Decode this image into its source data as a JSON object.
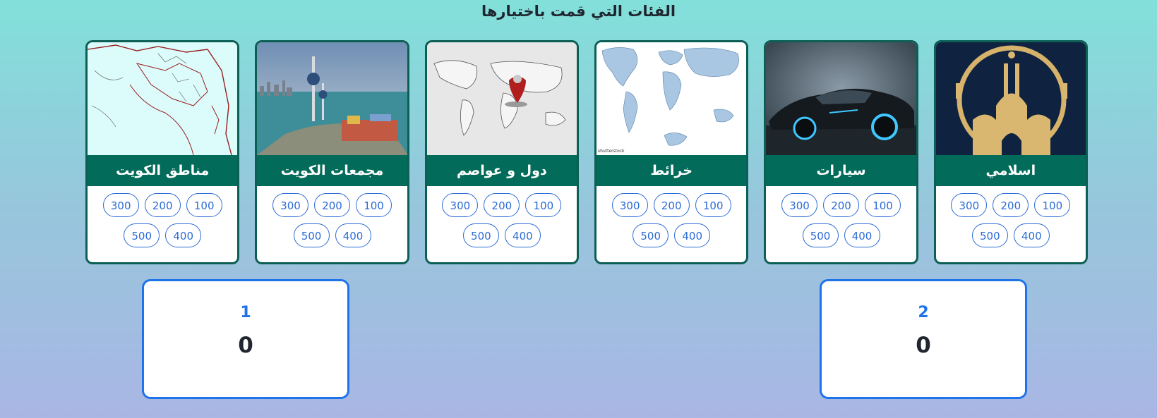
{
  "page_title": "الفئات التي قمت باختيارها",
  "categories": [
    {
      "title": "اسلامي",
      "image": "mosque-emblem-image",
      "values": [
        "100",
        "200",
        "300",
        "400",
        "500"
      ]
    },
    {
      "title": "سيارات",
      "image": "sports-car-image",
      "values": [
        "100",
        "200",
        "300",
        "400",
        "500"
      ]
    },
    {
      "title": "خرائط",
      "image": "world-map-image",
      "image_text": "shutterstock",
      "values": [
        "100",
        "200",
        "300",
        "400",
        "500"
      ]
    },
    {
      "title": "دول و عواصم",
      "image": "map-pin-image",
      "values": [
        "100",
        "200",
        "300",
        "400",
        "500"
      ]
    },
    {
      "title": "مجمعات الكويت",
      "image": "kuwait-towers-image",
      "values": [
        "100",
        "200",
        "300",
        "400",
        "500"
      ]
    },
    {
      "title": "مناطق الكويت",
      "image": "kuwait-areas-map-image",
      "values": [
        "100",
        "200",
        "300",
        "400",
        "500"
      ]
    }
  ],
  "teams": [
    {
      "name": "1",
      "score": "0"
    },
    {
      "name": "2",
      "score": "0"
    }
  ],
  "colors": {
    "card_header": "#036b59",
    "card_border": "#0c5f54",
    "value_accent": "#2c6bd6",
    "team_accent": "#1f73ea"
  }
}
